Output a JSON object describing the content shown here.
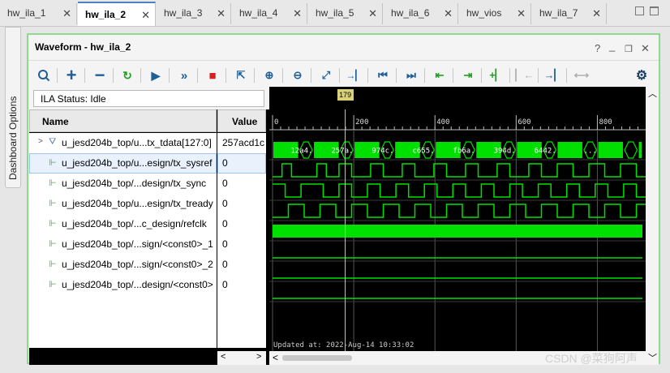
{
  "tabs": [
    {
      "label": "hw_ila_1",
      "active": false
    },
    {
      "label": "hw_ila_2",
      "active": true
    },
    {
      "label": "hw_ila_3",
      "active": false
    },
    {
      "label": "hw_ila_4",
      "active": false
    },
    {
      "label": "hw_ila_5",
      "active": false
    },
    {
      "label": "hw_ila_6",
      "active": false
    },
    {
      "label": "hw_vios",
      "active": false
    },
    {
      "label": "hw_ila_7",
      "active": false
    }
  ],
  "sidebar": {
    "label": "Dashboard Options"
  },
  "panel": {
    "title": "Waveform - hw_ila_2",
    "help": "?",
    "minimize": "_",
    "restore": "❐",
    "close": "✕"
  },
  "toolbar": {
    "icons": [
      "search-icon",
      "add-icon",
      "remove-icon",
      "run-trigger-immediate-icon",
      "run-trigger-icon",
      "run-trigger-continuous-icon",
      "stop-icon",
      "export-icon",
      "zoom-in-icon",
      "zoom-out-icon",
      "zoom-fit-icon",
      "go-to-cursor-icon",
      "go-to-start-icon",
      "go-to-end-icon",
      "previous-transition-icon",
      "next-transition-icon",
      "add-marker-icon",
      "previous-marker-icon",
      "next-marker-icon",
      "swap-cursors-icon",
      "settings-icon"
    ]
  },
  "status": {
    "text": "ILA Status: Idle"
  },
  "columns": {
    "name": "Name",
    "value": "Value"
  },
  "signals": [
    {
      "name": "u_jesd204b_top/u...tx_tdata[127:0]",
      "value": "257acd1c",
      "type": "bus",
      "expanded": false,
      "selected": false
    },
    {
      "name": "u_jesd204b_top/u...esign/tx_sysref",
      "value": "0",
      "type": "bit",
      "selected": true
    },
    {
      "name": "u_jesd204b_top/...design/tx_sync",
      "value": "0",
      "type": "bit",
      "selected": false
    },
    {
      "name": "u_jesd204b_top/u...esign/tx_tready",
      "value": "0",
      "type": "bit",
      "selected": false
    },
    {
      "name": "u_jesd204b_top/...c_design/refclk",
      "value": "0",
      "type": "bit",
      "selected": false
    },
    {
      "name": "u_jesd204b_top/...sign/<const0>_1",
      "value": "0",
      "type": "bit",
      "selected": false
    },
    {
      "name": "u_jesd204b_top/...sign/<const0>_2",
      "value": "0",
      "type": "bit",
      "selected": false
    },
    {
      "name": "u_jesd204b_top/...design/<const0>",
      "value": "0",
      "type": "bit",
      "selected": false
    }
  ],
  "timeline": {
    "ticks": [
      "0",
      "200",
      "400",
      "600",
      "800"
    ],
    "tick_values": [
      0,
      200,
      400,
      600,
      800
    ],
    "view_range": [
      0,
      911
    ],
    "cursor_label": "179",
    "cursor_value": 179
  },
  "bus_values": [
    "12a4...",
    "257a...",
    "974c...",
    "c655...",
    "fb6a...",
    "394d...",
    "6442...",
    "..."
  ],
  "waveforms": {
    "tx_sysref": [
      [
        0,
        3
      ],
      [
        2,
        3
      ],
      [
        0,
        8
      ],
      [
        2,
        3
      ],
      [
        0,
        4
      ],
      [
        1,
        4
      ],
      [
        0,
        6
      ],
      [
        2,
        4
      ],
      [
        0,
        6
      ],
      [
        2,
        4
      ],
      [
        0,
        6
      ],
      [
        2,
        4
      ],
      [
        0,
        6
      ],
      [
        2,
        4
      ],
      [
        0,
        6
      ],
      [
        2,
        4
      ],
      [
        0,
        6
      ],
      [
        2,
        4
      ],
      [
        0,
        5
      ],
      [
        2,
        5
      ],
      [
        0,
        5
      ],
      [
        2,
        5
      ],
      [
        0,
        5
      ],
      [
        2,
        5
      ],
      [
        0,
        5
      ],
      [
        2,
        5
      ],
      [
        0,
        5
      ],
      [
        2,
        5
      ],
      [
        0,
        5
      ],
      [
        2,
        5
      ],
      [
        0,
        5
      ],
      [
        2,
        5
      ],
      [
        0,
        5
      ],
      [
        2,
        5
      ],
      [
        0,
        5
      ],
      [
        2,
        5
      ]
    ],
    "tx_sync": [
      [
        2,
        4
      ],
      [
        0,
        5
      ],
      [
        1,
        7
      ],
      [
        0,
        5
      ],
      [
        2,
        4
      ],
      [
        0,
        5
      ],
      [
        2,
        4
      ],
      [
        0,
        5
      ],
      [
        2,
        4
      ],
      [
        0,
        5
      ],
      [
        2,
        4
      ],
      [
        0,
        5
      ],
      [
        2,
        4
      ],
      [
        0,
        5
      ],
      [
        2,
        4
      ],
      [
        0,
        5
      ],
      [
        2,
        4
      ],
      [
        0,
        5
      ],
      [
        2,
        4
      ],
      [
        0,
        5
      ],
      [
        2,
        4
      ],
      [
        0,
        5
      ],
      [
        2,
        4
      ],
      [
        0,
        5
      ],
      [
        2,
        4
      ],
      [
        0,
        5
      ],
      [
        2,
        4
      ],
      [
        0,
        5
      ],
      [
        2,
        4
      ],
      [
        0,
        5
      ],
      [
        2,
        4
      ],
      [
        0,
        5
      ],
      [
        2,
        4
      ],
      [
        0,
        5
      ],
      [
        2,
        4
      ],
      [
        0,
        5
      ],
      [
        2,
        4
      ],
      [
        0,
        5
      ],
      [
        2,
        4
      ],
      [
        0,
        5
      ],
      [
        2,
        4
      ],
      [
        0,
        5
      ],
      [
        2,
        4
      ],
      [
        0,
        5
      ],
      [
        2,
        4
      ],
      [
        0,
        5
      ],
      [
        2,
        4
      ],
      [
        0,
        5
      ],
      [
        2,
        4
      ]
    ],
    "tx_tready": [
      [
        0,
        5
      ],
      [
        2,
        5
      ],
      [
        0,
        5
      ],
      [
        2,
        5
      ],
      [
        0,
        5
      ],
      [
        2,
        5
      ],
      [
        0,
        5
      ],
      [
        2,
        5
      ],
      [
        0,
        5
      ],
      [
        2,
        5
      ],
      [
        0,
        5
      ],
      [
        2,
        5
      ],
      [
        0,
        5
      ],
      [
        2,
        5
      ],
      [
        0,
        5
      ],
      [
        2,
        5
      ],
      [
        0,
        5
      ],
      [
        2,
        5
      ],
      [
        0,
        5
      ],
      [
        2,
        5
      ],
      [
        0,
        5
      ],
      [
        2,
        5
      ],
      [
        0,
        5
      ],
      [
        2,
        5
      ],
      [
        0,
        5
      ],
      [
        2,
        5
      ],
      [
        0,
        5
      ],
      [
        2,
        5
      ],
      [
        0,
        5
      ],
      [
        2,
        5
      ],
      [
        0,
        5
      ],
      [
        2,
        5
      ],
      [
        0,
        5
      ],
      [
        2,
        5
      ],
      [
        0,
        5
      ],
      [
        2,
        5
      ],
      [
        0,
        5
      ],
      [
        2,
        5
      ],
      [
        0,
        5
      ],
      [
        2,
        5
      ],
      [
        0,
        5
      ],
      [
        2,
        5
      ],
      [
        0,
        5
      ],
      [
        2,
        5
      ],
      [
        0,
        5
      ],
      [
        2,
        5
      ],
      [
        0,
        5
      ]
    ]
  },
  "updated_text": "Updated at: 2022-Aug-14 10:33:02",
  "watermark": "CSDN @菜狗阿声",
  "colors": {
    "wave": "#00e000",
    "grid": "#bbbbbb",
    "cursor": "#d9d27a",
    "panel_border": "#8fd88f",
    "tab_active_accent": "#4f81bd"
  }
}
